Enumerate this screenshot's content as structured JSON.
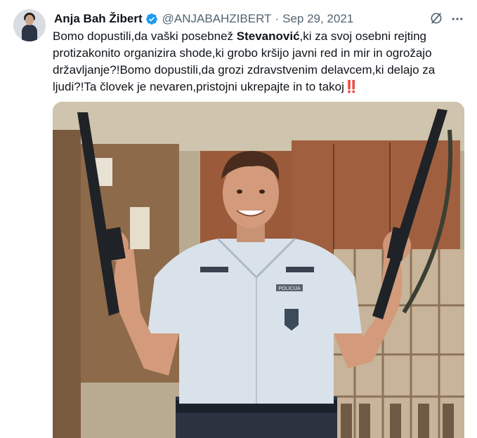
{
  "author": {
    "name": "Anja Bah Žibert",
    "handle": "@ANJABAHZIBERT",
    "separator": "·",
    "date": "Sep 29, 2021"
  },
  "tweet": {
    "text_part1": "Bomo dopustili,da vaški posebnež ",
    "text_bold": "Stevanović",
    "text_part2": ",ki za svoj osebni rejting protizakonito organizira shode,ki grobo kršijo javni red in mir in ogrožajo državljanje?!Bomo dopustili,da grozi zdravstvenim delavcem,ki delajo za ljudi?!Ta človek  je nevaren,pristojni ukrepajte in to takoj",
    "emoji": "‼️"
  },
  "media": {
    "badge_text": "POLICIJA"
  },
  "icons": {
    "verified": "verified-badge-icon",
    "grok": "grok-icon",
    "more": "more-icon"
  },
  "colors": {
    "verified_blue": "#1d9bf0",
    "secondary_text": "#536471",
    "emoji_red": "#e0245e"
  }
}
